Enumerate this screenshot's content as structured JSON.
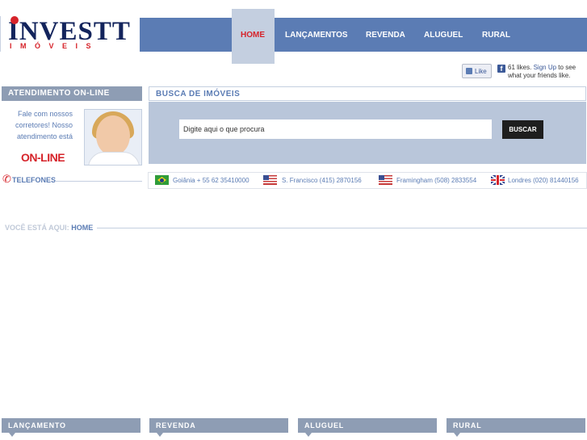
{
  "brand": {
    "name": "INVESTT",
    "sub": "IMÓVEIS"
  },
  "nav": {
    "items": [
      {
        "label": "HOME",
        "active": true
      },
      {
        "label": "LANÇAMENTOS"
      },
      {
        "label": "REVENDA"
      },
      {
        "label": "ALUGUEL"
      },
      {
        "label": "RURAL"
      }
    ]
  },
  "facebook": {
    "like_label": "Like",
    "count_text": "61 likes.",
    "signup": "Sign Up",
    "tail": "to see what your friends like."
  },
  "atendimento": {
    "title": "ATENDIMENTO ON-LINE",
    "text": "Fale com nossos corretores! Nosso atendimento está",
    "status": "ON-LINE"
  },
  "telefones": {
    "label": "TELEFONES"
  },
  "busca": {
    "title": "BUSCA DE IMÓVEIS",
    "placeholder": "Digite aqui o que procura",
    "button": "BUSCAR"
  },
  "phones": [
    {
      "flag": "brazil-flag-icon",
      "text": "Goiânia + 55 62 35410000"
    },
    {
      "flag": "usa-flag-icon",
      "text": "S. Francisco  (415) 2870156"
    },
    {
      "flag": "usa-flag-icon",
      "text": "Framingham (508) 2833554"
    },
    {
      "flag": "uk-flag-icon",
      "text": "Londres (020) 81440156"
    }
  ],
  "breadcrumb": {
    "prefix": "VOCÊ ESTÁ AQUI:",
    "current": "HOME"
  },
  "bottom_tabs": [
    "LANÇAMENTO",
    "REVENDA",
    "ALUGUEL",
    "RURAL"
  ],
  "colors": {
    "nav_bg": "#5b7cb4",
    "accent_red": "#d6232a",
    "header_gray": "#8e9db4",
    "search_bg": "#b9c6da"
  }
}
